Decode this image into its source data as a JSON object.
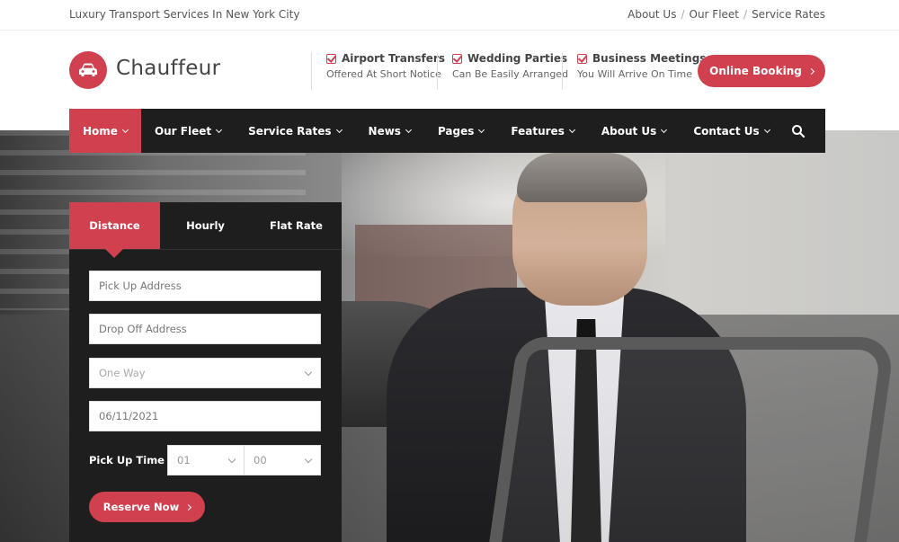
{
  "topbar": {
    "tagline": "Luxury Transport Services In New York City",
    "links": [
      "About Us",
      "Our Fleet",
      "Service Rates"
    ],
    "separator": "/"
  },
  "header": {
    "logo_text": "Chauffeur",
    "features": [
      {
        "title": "Airport Transfers",
        "subtitle": "Offered At Short Notice"
      },
      {
        "title": "Wedding Parties",
        "subtitle": "Can Be Easily Arranged"
      },
      {
        "title": "Business Meetings",
        "subtitle": "You Will Arrive On Time"
      }
    ],
    "booking_button": "Online Booking"
  },
  "nav": {
    "items": [
      {
        "label": "Home",
        "active": true
      },
      {
        "label": "Our Fleet"
      },
      {
        "label": "Service Rates"
      },
      {
        "label": "News"
      },
      {
        "label": "Pages"
      },
      {
        "label": "Features"
      },
      {
        "label": "About Us"
      },
      {
        "label": "Contact Us"
      }
    ]
  },
  "booking": {
    "tabs": [
      "Distance",
      "Hourly",
      "Flat Rate"
    ],
    "pickup_placeholder": "Pick Up Address",
    "dropoff_placeholder": "Drop Off Address",
    "trip_type": "One Way",
    "date": "06/11/2021",
    "time_label": "Pick Up Time",
    "hour": "01",
    "minute": "00",
    "reserve_button": "Reserve Now"
  },
  "colors": {
    "accent": "#d0404f",
    "nav_bg": "#1e1e1e"
  }
}
